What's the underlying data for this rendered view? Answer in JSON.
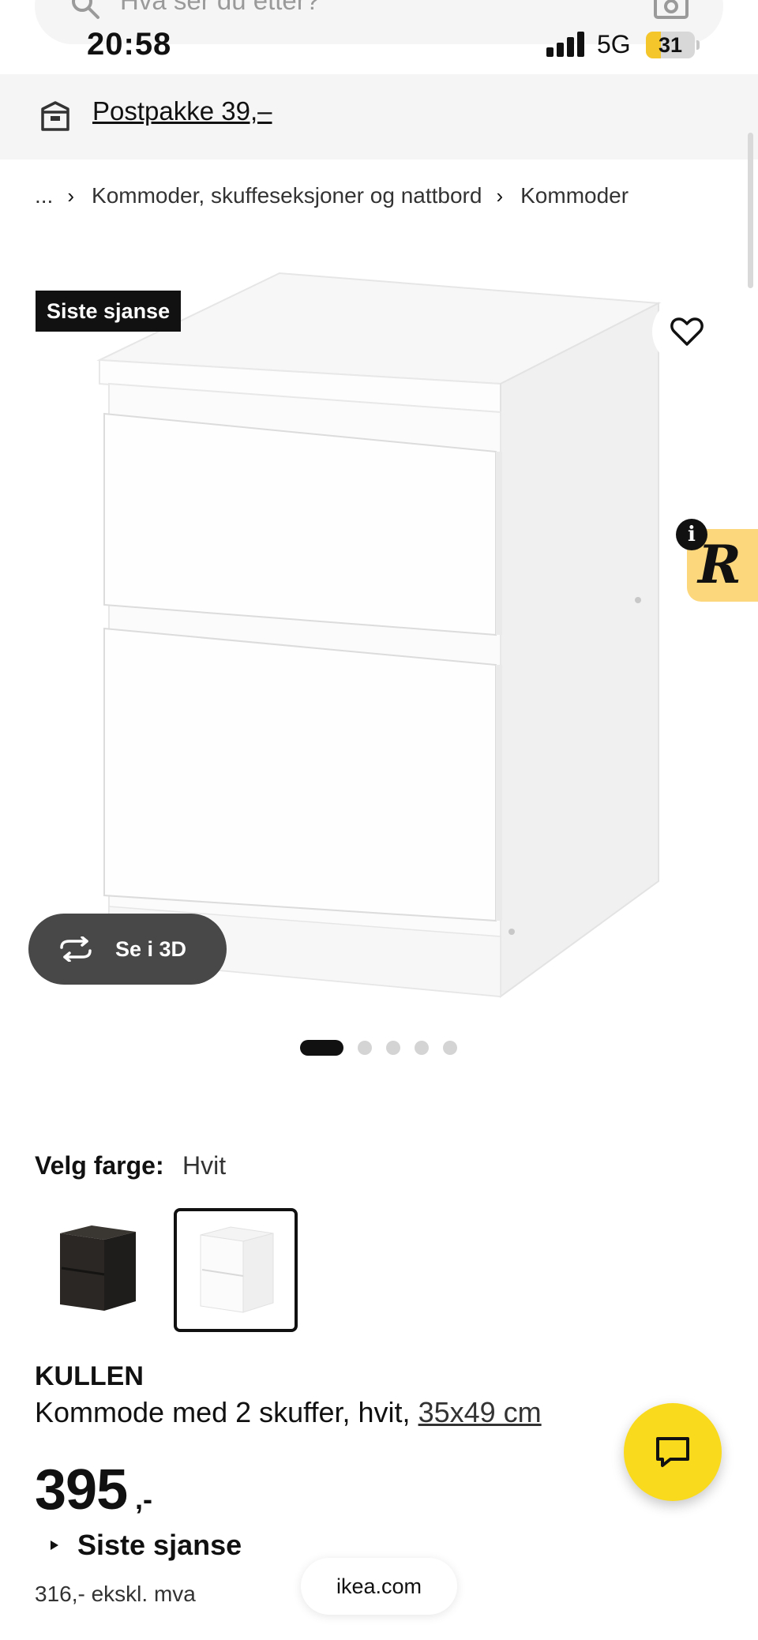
{
  "search": {
    "placeholder": "Hva ser du etter?"
  },
  "status_bar": {
    "time": "20:58",
    "network": "5G",
    "battery": "31",
    "battery_level": 0.31
  },
  "banner": {
    "text": "Postpakke 39,–"
  },
  "breadcrumb": {
    "ellipsis": "...",
    "items": [
      "Kommoder, skuffeseksjoner og nattbord",
      "Kommoder"
    ]
  },
  "product": {
    "badge": "Siste sjanse",
    "view3d_label": "Se i 3D",
    "image_count": 5,
    "active_image": 1,
    "color_label": "Velg farge:",
    "color_value": "Hvit",
    "colors": [
      "Svartbrun",
      "Hvit"
    ],
    "selected_color": 1,
    "name": "KULLEN",
    "description": "Kommode med 2 skuffer, hvit,",
    "size": "35x49 cm",
    "price": "395",
    "price_suffix": ",-",
    "status": "Siste sjanse",
    "price_ex_vat": "316,- ekskl. mva"
  },
  "browser": {
    "url": "ikea.com"
  },
  "colors": {
    "accent": "#fada1d",
    "banner_bg": "#f5f5f5",
    "badge_bg": "#111111",
    "rr_badge": "#fcd77c"
  }
}
